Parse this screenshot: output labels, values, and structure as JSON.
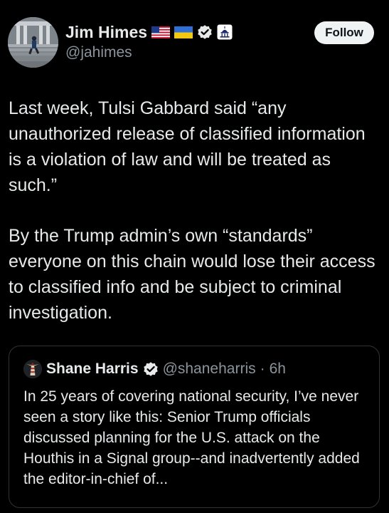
{
  "author": {
    "name": "Jim Himes",
    "handle": "@jahimes",
    "badges": [
      "us-flag-icon",
      "ukraine-flag-icon",
      "verified-badge-icon",
      "government-capitol-icon"
    ]
  },
  "follow_label": "Follow",
  "post": {
    "paragraphs": [
      "Last week, Tulsi Gabbard said “any unauthorized release of classified information is a violation of law and will be treated as such.”",
      "By the Trump admin’s own “standards” everyone on this chain would lose their access to classified info and be subject to criminal investigation."
    ]
  },
  "quoted": {
    "name": "Shane Harris",
    "handle": "@shaneharris",
    "separator": "·",
    "time": "6h",
    "text": "In 25 years of covering national security, I’ve never seen a story like this: Senior Trump officials discussed planning for the U.S. attack on the Houthis in a Signal group--and inadvertently added the editor-in-chief of..."
  },
  "colors": {
    "background": "#000000",
    "text": "#e7e9ea",
    "secondary": "#8b949c",
    "verified": "#ffffff",
    "border": "#2f3336"
  }
}
